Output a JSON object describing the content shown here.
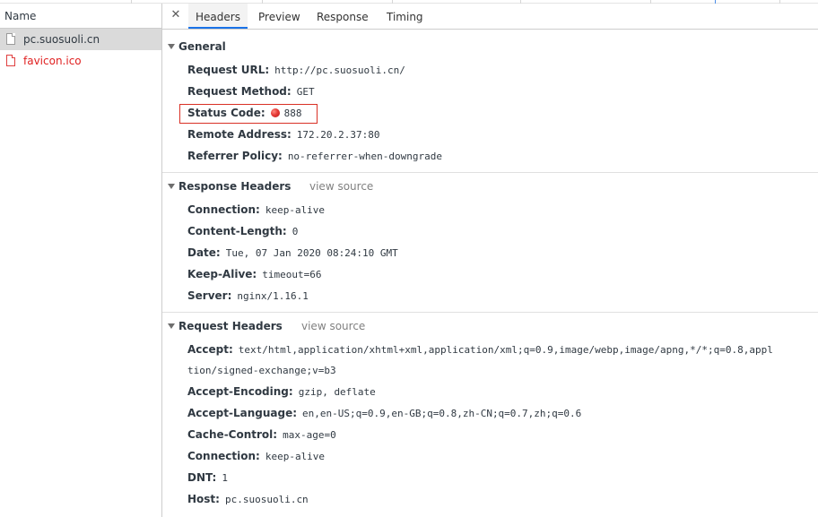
{
  "left_pane": {
    "column_header": "Name",
    "requests": [
      {
        "name": "pc.suosuoli.cn",
        "state": "selected"
      },
      {
        "name": "favicon.ico",
        "state": "error"
      }
    ]
  },
  "tabs": {
    "close_icon": "close-icon",
    "items": [
      {
        "label": "Headers",
        "active": true
      },
      {
        "label": "Preview",
        "active": false
      },
      {
        "label": "Response",
        "active": false
      },
      {
        "label": "Timing",
        "active": false
      }
    ]
  },
  "general": {
    "title": "General",
    "rows": [
      {
        "key": "Request URL:",
        "value": "http://pc.suosuoli.cn/"
      },
      {
        "key": "Request Method:",
        "value": "GET"
      },
      {
        "key": "Status Code:",
        "value": "888",
        "status_color": "#e53935"
      },
      {
        "key": "Remote Address:",
        "value": "172.20.2.37:80"
      },
      {
        "key": "Referrer Policy:",
        "value": "no-referrer-when-downgrade"
      }
    ]
  },
  "response_headers": {
    "title": "Response Headers",
    "view_source": "view source",
    "rows": [
      {
        "key": "Connection:",
        "value": "keep-alive"
      },
      {
        "key": "Content-Length:",
        "value": "0"
      },
      {
        "key": "Date:",
        "value": "Tue, 07 Jan 2020 08:24:10 GMT"
      },
      {
        "key": "Keep-Alive:",
        "value": "timeout=66"
      },
      {
        "key": "Server:",
        "value": "nginx/1.16.1"
      }
    ]
  },
  "request_headers": {
    "title": "Request Headers",
    "view_source": "view source",
    "rows": [
      {
        "key": "Accept:",
        "value": "text/html,application/xhtml+xml,application/xml;q=0.9,image/webp,image/apng,*/*;q=0.8,appl",
        "continuation": "tion/signed-exchange;v=b3"
      },
      {
        "key": "Accept-Encoding:",
        "value": "gzip, deflate"
      },
      {
        "key": "Accept-Language:",
        "value": "en,en-US;q=0.9,en-GB;q=0.8,zh-CN;q=0.7,zh;q=0.6"
      },
      {
        "key": "Cache-Control:",
        "value": "max-age=0"
      },
      {
        "key": "Connection:",
        "value": "keep-alive"
      },
      {
        "key": "DNT:",
        "value": "1"
      },
      {
        "key": "Host:",
        "value": "pc.suosuoli.cn"
      }
    ]
  },
  "colors": {
    "active_tab_underline": "#1a73e8",
    "error_text": "#e02020",
    "status_highlight_border": "#d93025"
  }
}
